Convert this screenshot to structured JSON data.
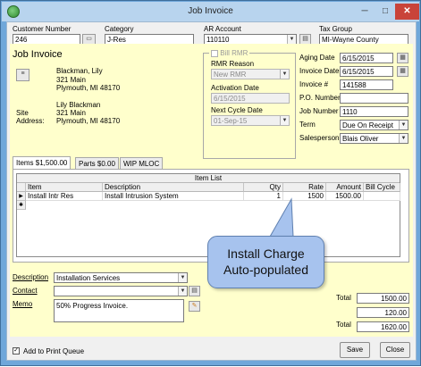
{
  "window": {
    "title": "Job Invoice",
    "minimize": "─",
    "maximize": "□",
    "close": "✕",
    "app_icon": "app-logo-icon"
  },
  "header": {
    "customer_number": {
      "label": "Customer Number",
      "value": "246"
    },
    "category": {
      "label": "Category",
      "value": "J-Res"
    },
    "ar_account": {
      "label": "AR Account",
      "value": "110110"
    },
    "tax_group": {
      "label": "Tax Group",
      "value": "MI-Wayne County"
    }
  },
  "form_title": "Job Invoice",
  "addresses": {
    "bill_name": "Blackman, Lily",
    "bill_street": "321 Main",
    "bill_city": "Plymouth, MI  48170",
    "site_label_1": "Site",
    "site_label_2": "Address:",
    "site_name": "Lily Blackman",
    "site_street": "321 Main",
    "site_city": "Plymouth, MI  48170"
  },
  "rmr": {
    "bill_rmr_label": "Bill RMR",
    "reason_label": "RMR Reason",
    "reason_value": "New RMR",
    "activation_label": "Activation Date",
    "activation_value": "6/15/2015",
    "next_cycle_label": "Next Cycle Date",
    "next_cycle_value": "01-Sep-15"
  },
  "details": {
    "aging_date": {
      "label": "Aging Date",
      "value": "6/15/2015"
    },
    "invoice_date": {
      "label": "Invoice Date",
      "value": "6/15/2015"
    },
    "invoice_number": {
      "label": "Invoice #",
      "value": "141588"
    },
    "po_number": {
      "label": "P.O. Number",
      "value": ""
    },
    "job_number": {
      "label": "Job Number",
      "value": "1110"
    },
    "term": {
      "label": "Term",
      "value": "Due On Receipt"
    },
    "salesperson": {
      "label": "Salesperson",
      "value": "Blais Oliver"
    }
  },
  "tabs": [
    {
      "label": "Items  $1,500.00"
    },
    {
      "label": "Parts  $0.00"
    },
    {
      "label": "WIP MLOC"
    }
  ],
  "grid": {
    "caption": "Item List",
    "columns": [
      "Item",
      "Description",
      "Qty",
      "Rate",
      "Amount",
      "Bill Cycle"
    ],
    "rows": [
      {
        "item": "Install Intr Res",
        "description": "Install Intrusion System",
        "qty": "1",
        "rate": "1500",
        "amount": "1500.00",
        "bill_cycle": ""
      }
    ],
    "current_row_marker": "▶",
    "new_row_marker": "✱"
  },
  "callout": {
    "line1": "Install Charge",
    "line2": "Auto-populated"
  },
  "bottom": {
    "description": {
      "label": "Description",
      "value": "Installation Services"
    },
    "contact": {
      "label": "Contact",
      "value": ""
    },
    "memo": {
      "label": "Memo",
      "value": "50% Progress Invoice."
    }
  },
  "totals": [
    {
      "label": "Total",
      "value": "1500.00"
    },
    {
      "label": "",
      "value": "120.00"
    },
    {
      "label": "Total",
      "value": "1620.00"
    }
  ],
  "footer": {
    "add_to_print_queue": "Add to Print Queue",
    "save": "Save",
    "close": "Close"
  }
}
